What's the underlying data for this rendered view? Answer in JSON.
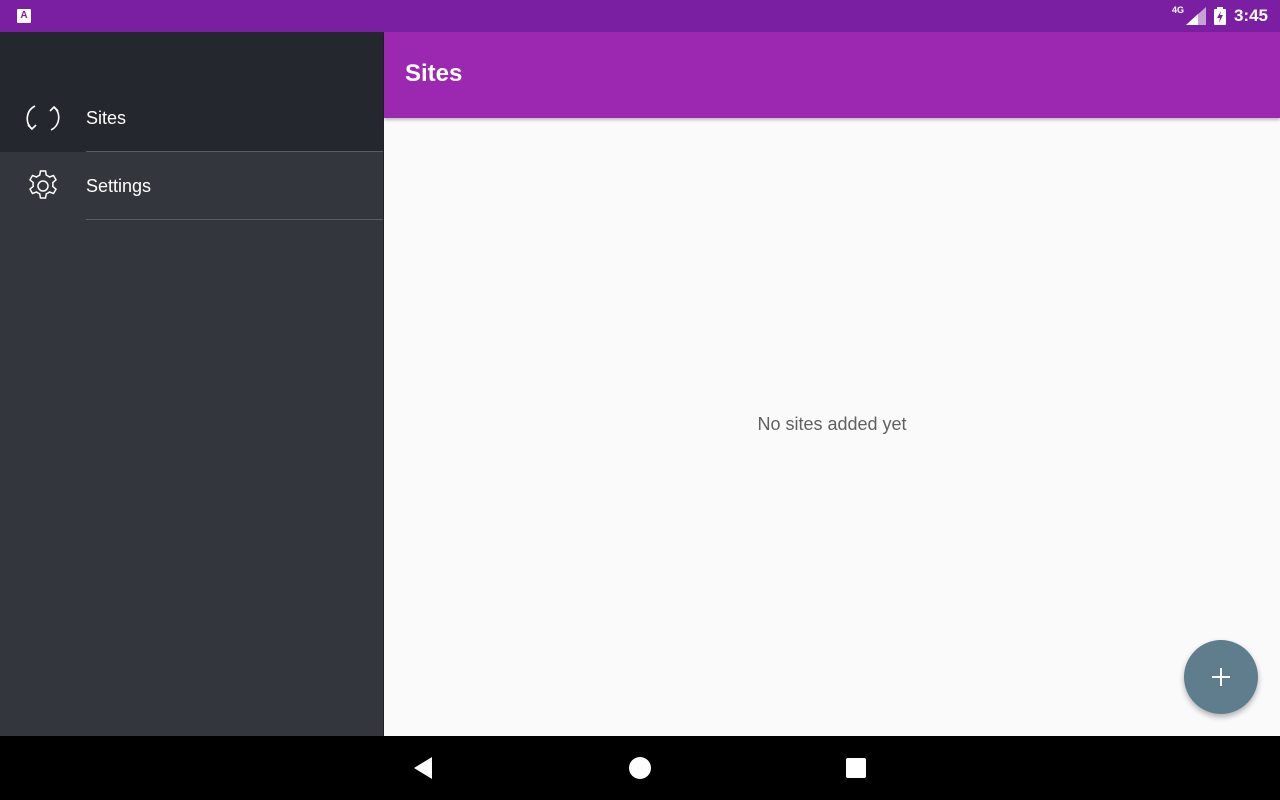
{
  "status_bar": {
    "keyboard_icon_letter": "A",
    "network_label": "4G",
    "time": "3:45",
    "background": "#7b1fa2"
  },
  "drawer": {
    "items": [
      {
        "label": "Sites",
        "icon": "sync-icon",
        "active": true
      },
      {
        "label": "Settings",
        "icon": "gear-icon",
        "active": false
      }
    ]
  },
  "app_bar": {
    "title": "Sites",
    "background": "#9c27b0"
  },
  "main": {
    "empty_message": "No sites added yet",
    "fab_icon": "plus-icon",
    "fab_color": "#5f7d8c"
  },
  "nav_bar": {
    "buttons": [
      "back-icon",
      "home-icon",
      "recents-icon"
    ]
  }
}
